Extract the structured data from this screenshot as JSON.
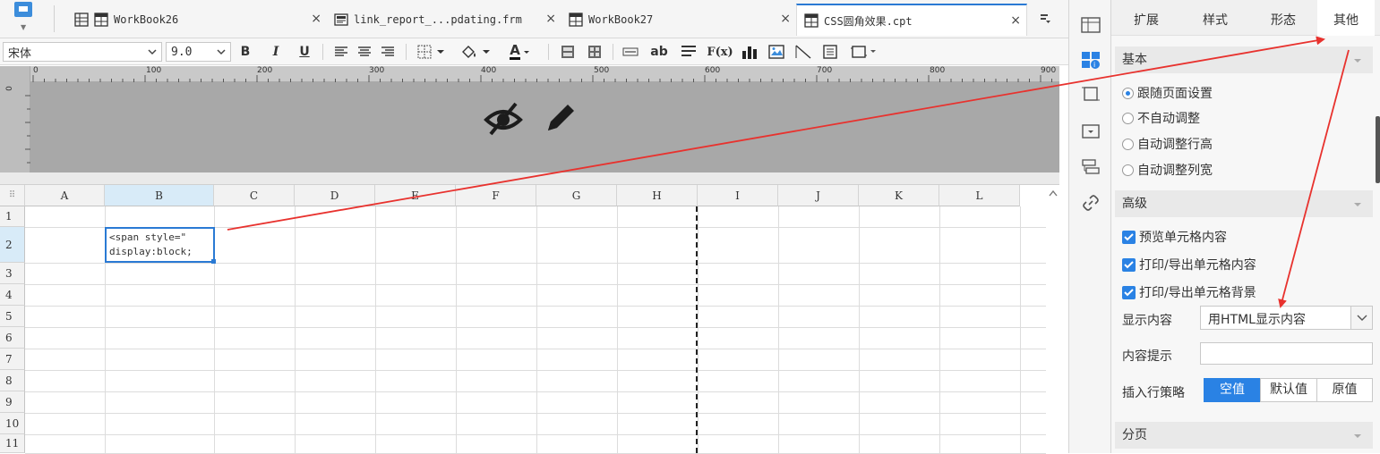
{
  "tabs": [
    {
      "label": "WorkBook26",
      "icon": "grid-icon"
    },
    {
      "label": "link_report_...pdating.frm",
      "icon": "form-icon"
    },
    {
      "label": "WorkBook27",
      "icon": "grid-icon"
    },
    {
      "label": "CSS圆角效果.cpt",
      "icon": "grid-icon",
      "active": true
    }
  ],
  "tab_close": "×",
  "toolbar": {
    "font_family": "宋体",
    "font_size": "9.0",
    "bold": "B",
    "italic": "I",
    "underline": "U",
    "text_style": "ab",
    "formula": "F(x)",
    "font_color": "A"
  },
  "ruler": {
    "ticks": [
      "0",
      "100",
      "200",
      "300",
      "400",
      "500",
      "600",
      "700",
      "800",
      "900"
    ]
  },
  "grid": {
    "corner": "⠿",
    "columns": [
      "A",
      "B",
      "C",
      "D",
      "E",
      "F",
      "G",
      "H",
      "I",
      "J",
      "K",
      "L"
    ],
    "rows": [
      "1",
      "2",
      "3",
      "4",
      "5",
      "6",
      "7",
      "8",
      "9",
      "10",
      "11"
    ],
    "selected_cell_text_line1": "<span style=\"",
    "selected_cell_text_line2": "display:block;"
  },
  "panel": {
    "tabs": [
      "扩展",
      "样式",
      "形态",
      "其他"
    ],
    "active_tab": "其他",
    "basic": {
      "title": "基本",
      "options": [
        "跟随页面设置",
        "不自动调整",
        "自动调整行高",
        "自动调整列宽"
      ],
      "selected": "跟随页面设置"
    },
    "advanced": {
      "title": "高级",
      "checks": [
        "预览单元格内容",
        "打印/导出单元格内容",
        "打印/导出单元格背景"
      ],
      "display_label": "显示内容",
      "display_value": "用HTML显示内容",
      "tooltip_label": "内容提示",
      "tooltip_value": "",
      "insert_label": "插入行策略",
      "insert_options": [
        "空值",
        "默认值",
        "原值"
      ],
      "insert_selected": "空值"
    },
    "paging": {
      "title": "分页"
    }
  },
  "colors": {
    "accent": "#2a82e4",
    "arrow": "#e8322e",
    "selection": "#2a7ad4"
  }
}
